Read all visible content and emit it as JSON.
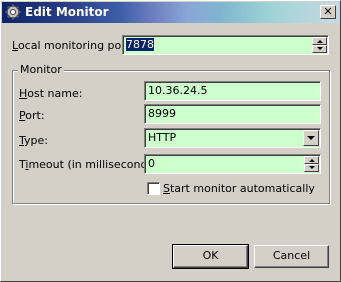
{
  "window": {
    "title": "Edit Monitor",
    "close_glyph": "✕"
  },
  "local_port": {
    "label_mnemonic": "L",
    "label_rest": "ocal monitoring port:",
    "value": "7878"
  },
  "monitor": {
    "group_title": "Monitor",
    "host": {
      "label_mnemonic": "H",
      "label_rest": "ost name:",
      "value": "10.36.24.5"
    },
    "port": {
      "label_mnemonic": "P",
      "label_rest": "ort:",
      "value": "8999"
    },
    "type": {
      "label_mnemonic": "T",
      "label_rest": "ype:",
      "value": "HTTP"
    },
    "timeout": {
      "label_pre": "T",
      "label_mnemonic": "i",
      "label_rest": "meout (in milliseconds):",
      "value": "0"
    },
    "auto_start": {
      "label_mnemonic": "S",
      "label_rest": "tart monitor automatically",
      "checked": false
    }
  },
  "buttons": {
    "ok": "OK",
    "cancel": "Cancel"
  },
  "colors": {
    "field_bg": "#ccffcc",
    "dialog_bg": "#d4d0c8",
    "title_start": "#0a246a"
  }
}
